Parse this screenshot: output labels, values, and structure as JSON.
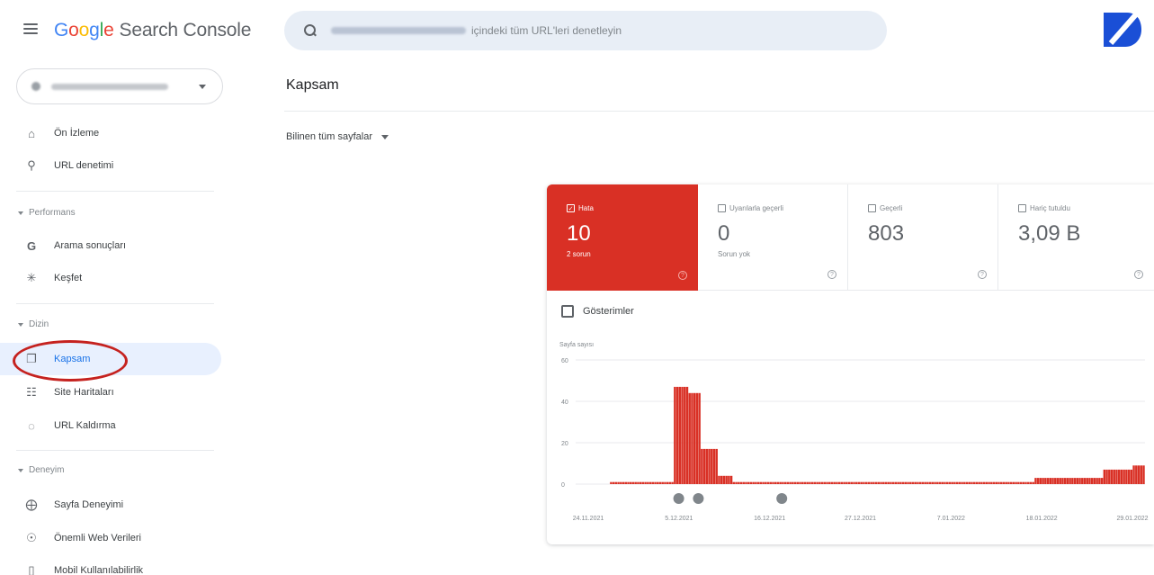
{
  "app": {
    "title_letters": [
      "G",
      "o",
      "o",
      "g",
      "l",
      "e"
    ],
    "title_rest": "Search Console"
  },
  "search": {
    "placeholder": "içindeki tüm URL'leri denetleyin"
  },
  "sidebar": {
    "top_items": [
      {
        "label": "Ön İzleme",
        "icon": "home-icon"
      },
      {
        "label": "URL denetimi",
        "icon": "search-icon"
      }
    ],
    "sections": [
      {
        "label": "Performans",
        "items": [
          {
            "label": "Arama sonuçları",
            "icon": "google-g-icon"
          },
          {
            "label": "Keşfet",
            "icon": "asterisk-icon"
          }
        ]
      },
      {
        "label": "Dizin",
        "items": [
          {
            "label": "Kapsam",
            "icon": "file-copy-icon",
            "active": true
          },
          {
            "label": "Site Haritaları",
            "icon": "sitemap-icon"
          },
          {
            "label": "URL Kaldırma",
            "icon": "eye-off-icon"
          }
        ]
      },
      {
        "label": "Deneyim",
        "items": [
          {
            "label": "Sayfa Deneyimi",
            "icon": "circle-plus-icon"
          },
          {
            "label": "Önemli Web Verileri",
            "icon": "speed-icon"
          },
          {
            "label": "Mobil Kullanılabilirlik",
            "icon": "phone-icon"
          }
        ]
      }
    ]
  },
  "main": {
    "title": "Kapsam",
    "filter": "Bilinen tüm sayfalar",
    "tiles": [
      {
        "label": "Hata",
        "value": "10",
        "sub": "2 sorun",
        "checked": true,
        "color": "#d93025"
      },
      {
        "label": "Uyarılarla geçerli",
        "value": "0",
        "sub": "Sorun yok",
        "checked": false
      },
      {
        "label": "Geçerli",
        "value": "803",
        "sub": "",
        "checked": false
      },
      {
        "label": "Hariç tutuldu",
        "value": "3,09 B",
        "sub": "",
        "checked": false
      }
    ],
    "impressions_label": "Gösterimler"
  },
  "chart_data": {
    "type": "bar",
    "ylabel": "Sayfa sayısı",
    "ylim": [
      0,
      60
    ],
    "yticks": [
      0,
      20,
      40,
      60
    ],
    "bar_color": "#d93025",
    "x_tick_labels": [
      "24.11.2021",
      "5.12.2021",
      "16.12.2021",
      "27.12.2021",
      "7.01.2022",
      "18.01.2022",
      "29.01.2022"
    ],
    "values": [
      0,
      0,
      0,
      0,
      0,
      0,
      0,
      0,
      0,
      0,
      0,
      0,
      0,
      0,
      0,
      0,
      0,
      0,
      0,
      0,
      0,
      0,
      0,
      0,
      0,
      0,
      0,
      0,
      0,
      0,
      0,
      0,
      0,
      0,
      0,
      0,
      0,
      0,
      0,
      0,
      0,
      0,
      0,
      0,
      0,
      0,
      0,
      0,
      0,
      0,
      0,
      0,
      0,
      0,
      0,
      0,
      0,
      0,
      0,
      0,
      0,
      0,
      0,
      0,
      0,
      0,
      0,
      0,
      0,
      0,
      0,
      0,
      0,
      0,
      0,
      0,
      0,
      0,
      0,
      0,
      0,
      0,
      0,
      0,
      0
    ],
    "values_note_omitted": true,
    "series": [
      {
        "values": [
          0,
          0,
          0,
          0,
          0,
          0,
          0,
          0,
          0,
          0,
          0,
          0,
          0,
          0,
          1,
          1,
          1,
          1,
          1,
          1,
          1,
          1,
          1,
          1,
          1,
          1,
          1,
          1,
          1,
          1,
          1,
          1,
          1,
          1,
          1,
          1,
          1,
          1,
          1,
          1,
          47,
          47,
          47,
          47,
          47,
          47,
          44,
          44,
          44,
          44,
          44,
          17,
          17,
          17,
          17,
          17,
          17,
          17,
          4,
          4,
          4,
          4,
          4,
          4,
          1,
          1,
          1,
          1,
          1,
          1,
          1,
          1,
          1,
          1,
          1,
          1,
          1,
          1,
          1,
          1,
          1,
          1,
          1,
          1,
          1,
          1,
          1,
          1,
          1,
          1,
          1,
          1,
          1,
          1,
          1,
          1,
          1,
          1,
          1,
          1,
          1,
          1,
          1,
          1,
          1,
          1,
          1,
          1,
          1,
          1,
          1,
          1,
          1,
          1,
          1,
          1,
          1,
          1,
          1,
          1,
          1,
          1,
          1,
          1,
          1,
          1,
          1,
          1,
          1,
          1,
          1,
          1,
          1,
          1,
          1,
          1,
          1,
          1,
          1,
          1,
          1,
          1,
          1,
          1,
          1,
          1,
          1,
          1,
          1,
          1,
          1,
          1,
          1,
          1,
          1,
          1,
          1,
          1,
          1,
          1,
          1,
          1,
          1,
          1,
          1,
          1,
          1,
          1,
          1,
          1,
          1,
          1,
          1,
          1,
          1,
          1,
          1,
          1,
          1,
          1,
          1,
          1,
          1,
          1,
          1,
          1,
          1,
          3,
          3,
          3,
          3,
          3,
          3,
          3,
          3,
          3,
          3,
          3,
          3,
          3,
          3,
          3,
          3,
          3,
          3,
          3,
          3,
          3,
          3,
          3,
          3,
          3,
          3,
          3,
          3,
          7,
          7,
          7,
          7,
          7,
          7,
          7,
          7,
          7,
          7,
          7,
          7,
          9,
          9,
          9,
          9,
          9
        ]
      }
    ],
    "annotation_markers": 4
  }
}
